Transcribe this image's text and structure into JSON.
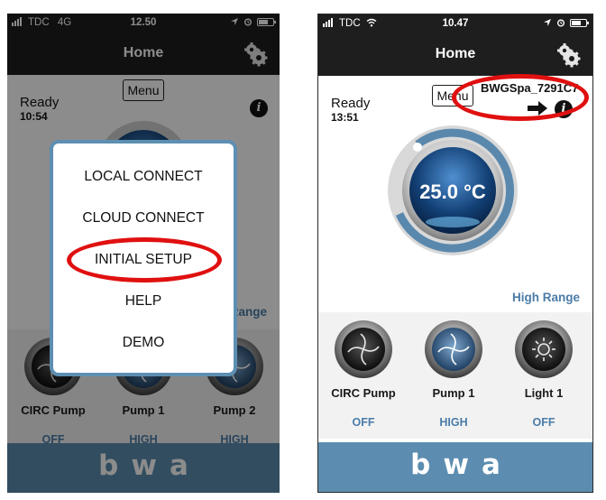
{
  "left": {
    "status": {
      "carrier": "TDC",
      "network": "4G",
      "time": "12.50"
    },
    "nav": {
      "title": "Home"
    },
    "ready": {
      "status": "Ready",
      "time": "10:54"
    },
    "menu_label": "Menu",
    "range_label": "Range",
    "popup": {
      "items": [
        "LOCAL CONNECT",
        "CLOUD CONNECT",
        "INITIAL SETUP",
        "HELP",
        "DEMO"
      ],
      "highlighted": "INITIAL SETUP"
    },
    "controls": [
      {
        "name": "CIRC Pump",
        "state": "OFF"
      },
      {
        "name": "Pump 1",
        "state": "HIGH"
      },
      {
        "name": "Pump 2",
        "state": "HIGH"
      }
    ],
    "footer_logo": "bwa"
  },
  "right": {
    "status": {
      "carrier": "TDC",
      "time": "10.47"
    },
    "nav": {
      "title": "Home"
    },
    "ready": {
      "status": "Ready",
      "time": "13:51"
    },
    "menu_label": "Menu",
    "device_name": "BWGSpa_7291C7",
    "temperature": "25.0 °C",
    "range_label": "High Range",
    "controls": [
      {
        "name": "CIRC Pump",
        "state": "OFF"
      },
      {
        "name": "Pump 1",
        "state": "HIGH"
      },
      {
        "name": "Light 1",
        "state": "OFF"
      }
    ],
    "footer_logo": "bwa"
  },
  "colors": {
    "accent": "#4a7ca8",
    "highlight": "#e01010",
    "bar": "#1e1e1e",
    "footer": "#5c8db0"
  },
  "icons": [
    "gear-icon",
    "info-icon",
    "location-arrow-icon",
    "alarm-icon",
    "battery-icon",
    "wifi-icon",
    "signal-icon",
    "pump-knob-icon",
    "light-knob-icon"
  ]
}
